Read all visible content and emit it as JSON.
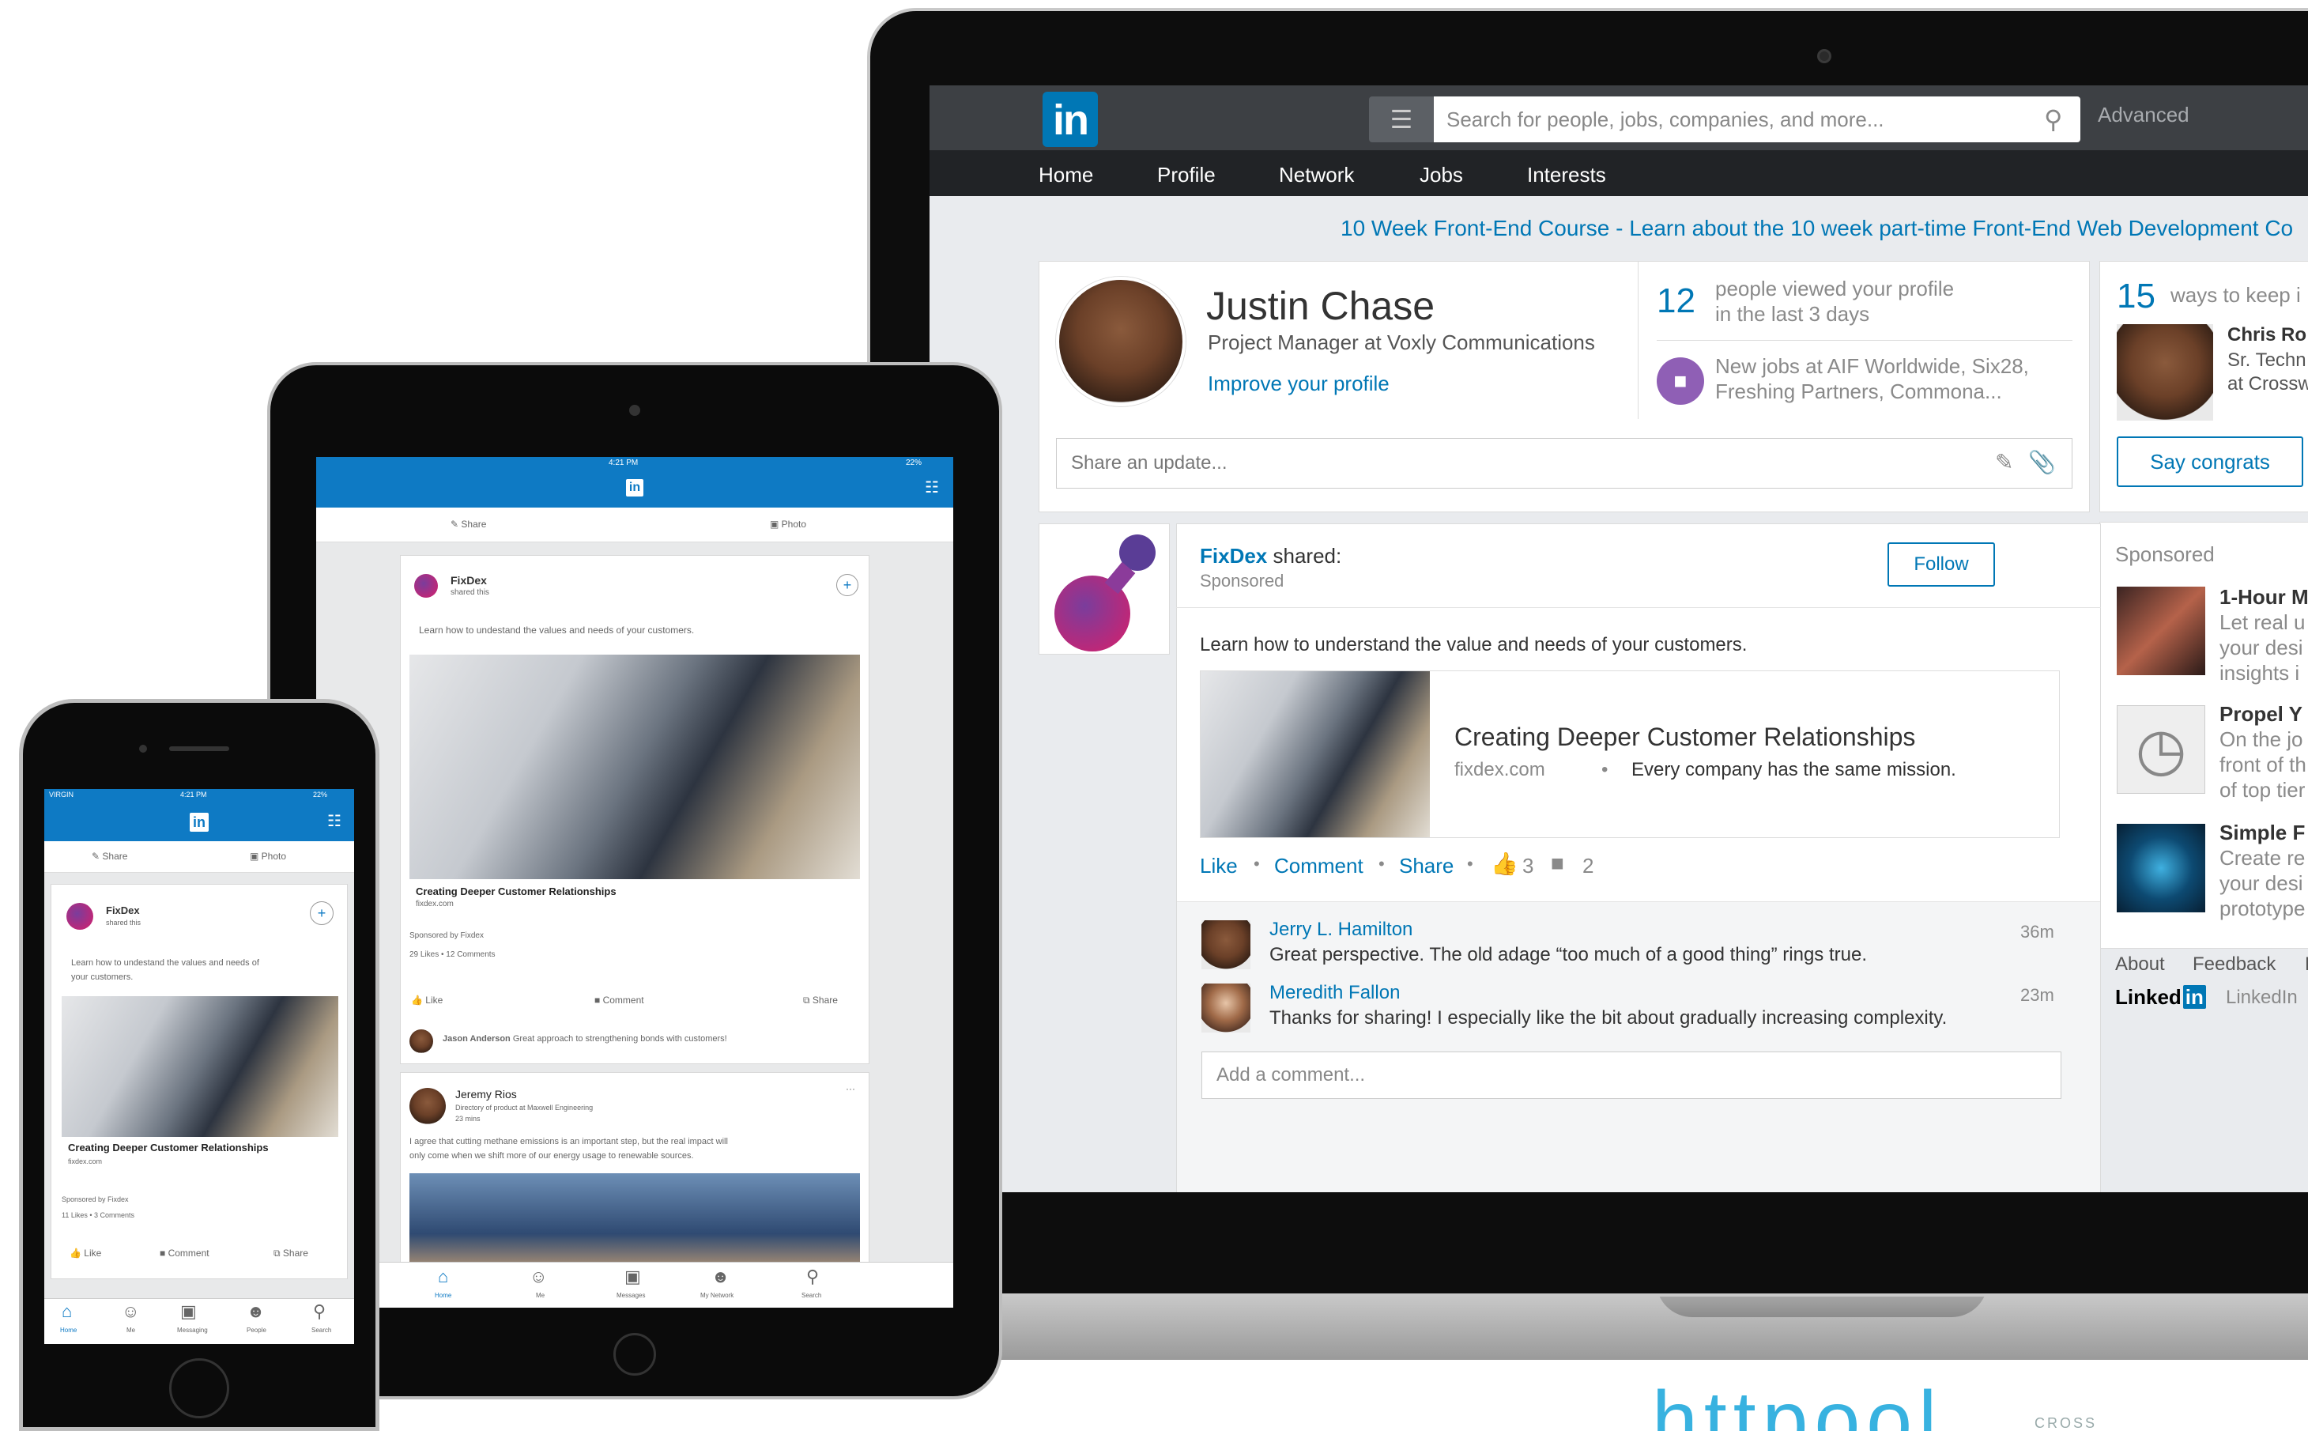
{
  "laptop": {
    "search_placeholder": "Search for people, jobs, companies, and more...",
    "advanced": "Advanced",
    "nav": [
      "Home",
      "Profile",
      "Network",
      "Jobs",
      "Interests"
    ],
    "banner": "10 Week Front-End Course - Learn about the 10 week part-time Front-End Web Development Co",
    "profile": {
      "name": "Justin Chase",
      "title": "Project Manager at Voxly Communications",
      "improve": "Improve your profile"
    },
    "stats": {
      "views_count": "12",
      "views_text_1": "people viewed your profile",
      "views_text_2": "in the last 3 days",
      "jobs_text_1": "New jobs at AIF Worldwide, Six28,",
      "jobs_text_2": "Freshing Partners, Commona..."
    },
    "share_placeholder": "Share an update...",
    "right": {
      "ways_count": "15",
      "ways_text": "ways to keep i",
      "person_name": "Chris Ro",
      "person_line1": "Sr. Techn",
      "person_line2": "at Crossw",
      "congrats": "Say congrats",
      "sponsored": "Sponsored",
      "ads": [
        {
          "title": "1-Hour M",
          "l1": "Let real u",
          "l2": "your desi",
          "l3": "insights i"
        },
        {
          "title": "Propel Y",
          "l1": "On the jo",
          "l2": "front of th",
          "l3": "of top tier"
        },
        {
          "title": "Simple F",
          "l1": "Create re",
          "l2": "your desi",
          "l3": "prototype"
        }
      ],
      "footer_about": "About",
      "footer_feedback": "Feedback",
      "footer_f": "F",
      "brand_word": "Linked",
      "brand_in": "in",
      "linkedin_text": "LinkedIn"
    },
    "post": {
      "company": "FixDex",
      "shared": "shared:",
      "sponsored": "Sponsored",
      "follow": "Follow",
      "text": "Learn how to understand the value and needs of your customers.",
      "article_title": "Creating Deeper Customer Relationships",
      "article_domain": "fixdex.com",
      "article_desc": "Every company has the same mission.",
      "like": "Like",
      "comment": "Comment",
      "share": "Share",
      "likes": "3",
      "comments": "2"
    },
    "comments": [
      {
        "name": "Jerry L. Hamilton",
        "text": "Great perspective. The old adage “too much of a good thing” rings true.",
        "time": "36m"
      },
      {
        "name": "Meredith Fallon",
        "text": "Thanks for sharing! I especially like the bit about gradually increasing complexity.",
        "time": "23m"
      }
    ],
    "add_comment": "Add a comment..."
  },
  "tablet": {
    "status_time": "4:21 PM",
    "battery": "22%",
    "share": "Share",
    "photo": "Photo",
    "post1": {
      "company": "FixDex",
      "shared": "shared this",
      "text": "Learn how to undestand the values and needs of your customers.",
      "article": "Creating Deeper Customer Relationships",
      "domain": "fixdex.com",
      "sponsored": "Sponsored by Fixdex",
      "stats": "29 Likes • 12 Comments",
      "like": "Like",
      "comment": "Comment",
      "share": "Share",
      "commenter": "Jason Anderson",
      "comment_text": "Great approach to strengthening bonds with customers!"
    },
    "post2": {
      "name": "Jeremy Rios",
      "role": "Directory of product at Maxwell Engineering",
      "time": "23 mins",
      "text_1": "I agree that cutting methane emissions is an important step, but the real impact will",
      "text_2": "only come when we shift more of our energy usage to renewable sources."
    },
    "tabs": [
      "Home",
      "Me",
      "Messages",
      "My Network",
      "Search"
    ]
  },
  "phone": {
    "carrier": "VIRGIN",
    "status_time": "4:21 PM",
    "battery": "22%",
    "share": "Share",
    "photo": "Photo",
    "post": {
      "company": "FixDex",
      "shared": "shared this",
      "text_1": "Learn how to undestand the values and needs of",
      "text_2": "your customers.",
      "article": "Creating Deeper Customer Relationships",
      "domain": "fixdex.com",
      "sponsored": "Sponsored by Fixdex",
      "stats": "11 Likes • 3 Comments",
      "like": "Like",
      "comment": "Comment",
      "share": "Share"
    },
    "tabs": [
      "Home",
      "Me",
      "Messaging",
      "People",
      "Search"
    ]
  },
  "watermark": {
    "text": "httpool",
    "small": "CROSS"
  },
  "colors": {
    "brand": "#0077b5",
    "header": "#3d4044",
    "nav": "#212326",
    "mobile_header": "#0e7ac4"
  }
}
